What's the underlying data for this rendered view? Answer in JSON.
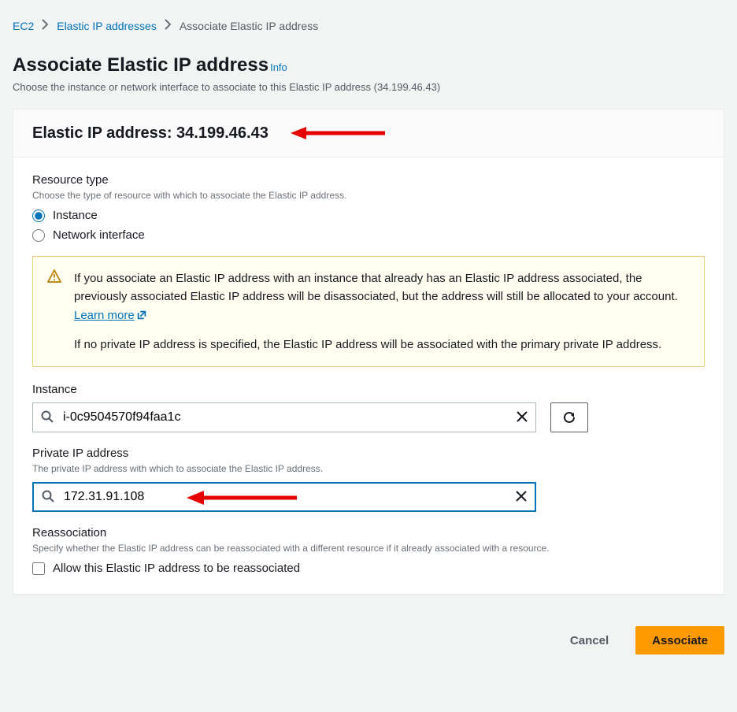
{
  "breadcrumb": {
    "root": "EC2",
    "mid": "Elastic IP addresses",
    "current": "Associate Elastic IP address"
  },
  "header": {
    "title": "Associate Elastic IP address",
    "info": "Info",
    "desc": "Choose the instance or network interface to associate to this Elastic IP address (34.199.46.43)"
  },
  "panel": {
    "title": "Elastic IP address: 34.199.46.43"
  },
  "resourceType": {
    "label": "Resource type",
    "hint": "Choose the type of resource with which to associate the Elastic IP address.",
    "options": {
      "instance": "Instance",
      "networkInterface": "Network interface"
    }
  },
  "notice": {
    "p1a": "If you associate an Elastic IP address with an instance that already has an Elastic IP address associated, the previously associated Elastic IP address will be disassociated, but the address will still be allocated to your account. ",
    "learn": "Learn more",
    "p2": "If no private IP address is specified, the Elastic IP address will be associated with the primary private IP address."
  },
  "instanceField": {
    "label": "Instance",
    "value": "i-0c9504570f94faa1c"
  },
  "privateIp": {
    "label": "Private IP address",
    "hint": "The private IP address with which to associate the Elastic IP address.",
    "value": "172.31.91.108"
  },
  "reassoc": {
    "label": "Reassociation",
    "hint": "Specify whether the Elastic IP address can be reassociated with a different resource if it already associated with a resource.",
    "checkboxLabel": "Allow this Elastic IP address to be reassociated"
  },
  "footer": {
    "cancel": "Cancel",
    "associate": "Associate"
  }
}
